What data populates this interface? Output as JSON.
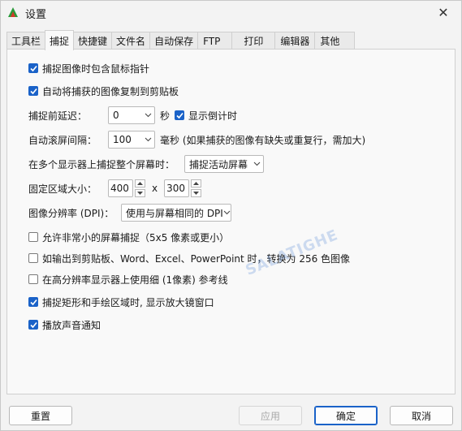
{
  "window": {
    "title": "设置",
    "close": "✕"
  },
  "tabs": [
    {
      "label": "工具栏"
    },
    {
      "label": "捕捉"
    },
    {
      "label": "快捷键"
    },
    {
      "label": "文件名"
    },
    {
      "label": "自动保存"
    },
    {
      "label": "FTP"
    },
    {
      "label": "打印"
    },
    {
      "label": "编辑器"
    },
    {
      "label": "其他"
    }
  ],
  "capture": {
    "include_cursor": "捕捉图像时包含鼠标指针",
    "copy_clipboard": "自动将捕获的图像复制到剪贴板",
    "delay_label": "捕捉前延迟：",
    "delay_value": "0",
    "delay_unit": "秒",
    "show_countdown": "显示倒计时",
    "scroll_label": "自动滚屏间隔：",
    "scroll_value": "100",
    "scroll_unit": "毫秒 (如果捕获的图像有缺失或重复行，需加大)",
    "multi_monitor_label": "在多个显示器上捕捉整个屏幕时：",
    "multi_monitor_value": "捕捉活动屏幕",
    "fixed_label": "固定区域大小：",
    "fixed_w": "400",
    "fixed_x": "x",
    "fixed_h": "300",
    "dpi_label": "图像分辨率 (DPI)：",
    "dpi_value": "使用与屏幕相同的 DPI",
    "allow_small": "允许非常小的屏幕捕捉（5x5 像素或更小）",
    "convert_256": "如输出到剪贴板、Word、Excel、PowerPoint 时，转换为 256 色图像",
    "thin_lines": "在高分辨率显示器上使用细 (1像素) 参考线",
    "show_magnifier": "捕捉矩形和手绘区域时, 显示放大镜窗口",
    "play_sound": "播放声音通知"
  },
  "footer": {
    "reset": "重置",
    "apply": "应用",
    "ok": "确定",
    "cancel": "取消"
  },
  "watermark": "SALATIGHE",
  "colors": {
    "accent": "#1a62c8"
  }
}
